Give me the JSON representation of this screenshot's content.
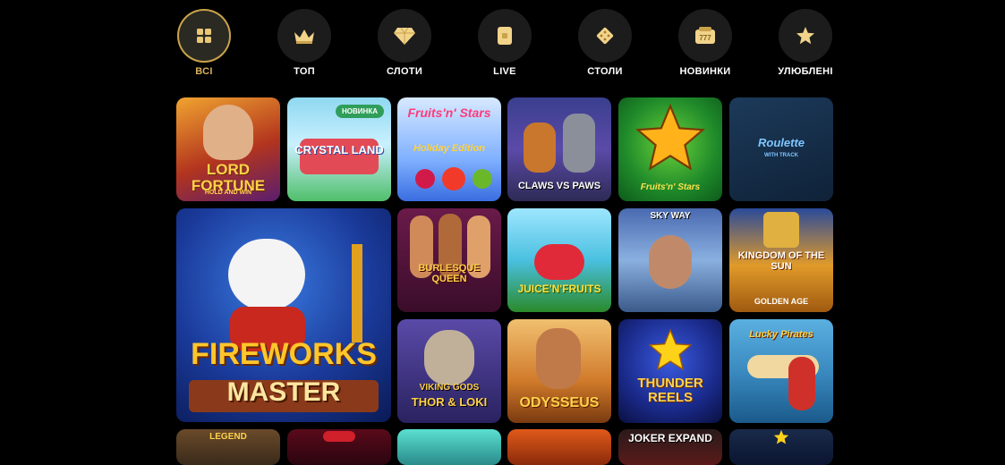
{
  "nav": {
    "items": [
      {
        "label": "ВСІ",
        "icon": "grid-icon"
      },
      {
        "label": "ТОП",
        "icon": "crown-icon"
      },
      {
        "label": "СЛОТИ",
        "icon": "diamond-icon"
      },
      {
        "label": "LIVE",
        "icon": "live-card-icon"
      },
      {
        "label": "СТОЛИ",
        "icon": "dice-icon"
      },
      {
        "label": "НОВИНКИ",
        "icon": "slot-777-icon"
      },
      {
        "label": "УЛЮБЛЕНІ",
        "icon": "star-icon"
      }
    ],
    "active_index": 0
  },
  "games": [
    {
      "title": "LORD FORTUNE",
      "subtitle": "HOLD AND WIN"
    },
    {
      "title": "CRYSTAL LAND",
      "badge": "НОВИНКА"
    },
    {
      "title": "Fruits'n' Stars",
      "subtitle": "Holiday Edition"
    },
    {
      "title": "CLAWS vs PAWS"
    },
    {
      "title": "Fruits'n' Stars"
    },
    {
      "title": "Roulette",
      "subtitle": "WITH TRACK"
    },
    {
      "title": "FIREWORKS",
      "subtitle": "MASTER"
    },
    {
      "title": "BURLESQUE QUEEN"
    },
    {
      "title": "JUICE'N'FRUITS"
    },
    {
      "title": "SKY WAY"
    },
    {
      "title": "KINGDOM of the SUN",
      "subtitle": "GOLDEN AGE"
    },
    {
      "title": "VIKING GODS",
      "subtitle": "THOR & LOKI"
    },
    {
      "title": "ODYSSEUS"
    },
    {
      "title": "THUNDER REELS"
    },
    {
      "title": "Lucky Pirates"
    },
    {
      "title": "LEGEND"
    },
    {
      "title": ""
    },
    {
      "title": ""
    },
    {
      "title": ""
    },
    {
      "title": "JOKER EXPAND"
    },
    {
      "title": ""
    }
  ],
  "colors": {
    "accent_gold": "#d9b25b",
    "background": "#000000",
    "nav_circle": "#1c1c1c",
    "badge_green": "#2f9e5a"
  }
}
